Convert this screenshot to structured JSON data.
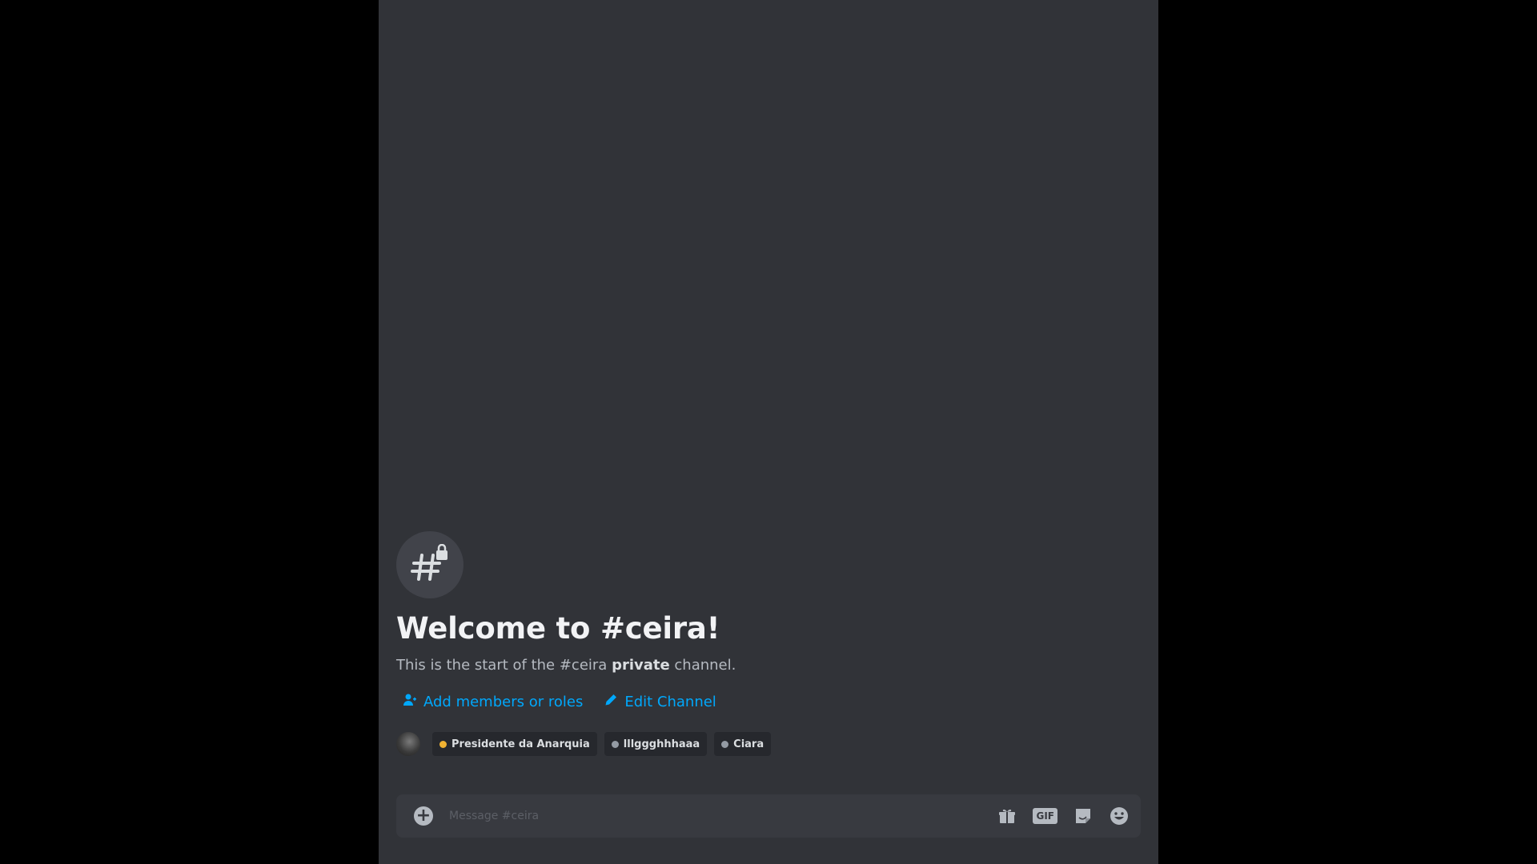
{
  "channel": {
    "name": "ceira",
    "welcome_title": "Welcome to #ceira!",
    "intro_prefix": "This is the start of the #ceira ",
    "intro_bold": "private",
    "intro_suffix": " channel.",
    "icon": "hashtag-lock-icon"
  },
  "actions": {
    "add_members_label": "Add members or roles",
    "add_members_icon": "add-user-icon",
    "edit_channel_label": "Edit Channel",
    "edit_channel_icon": "pencil-icon"
  },
  "members": [
    {
      "name": "Presidente da Anarquia",
      "color": "#f0b232"
    },
    {
      "name": "lllggghhhaaa",
      "color": "#949ba4"
    },
    {
      "name": "Ciara",
      "color": "#949ba4"
    }
  ],
  "composer": {
    "placeholder": "Message #ceira",
    "icons": [
      "plus-circle-icon",
      "gift-icon",
      "gif-icon",
      "sticker-icon",
      "emoji-icon"
    ],
    "gif_label": "GIF"
  },
  "colors": {
    "background": "#313338",
    "link": "#00a8fc",
    "composer": "#383a40"
  }
}
